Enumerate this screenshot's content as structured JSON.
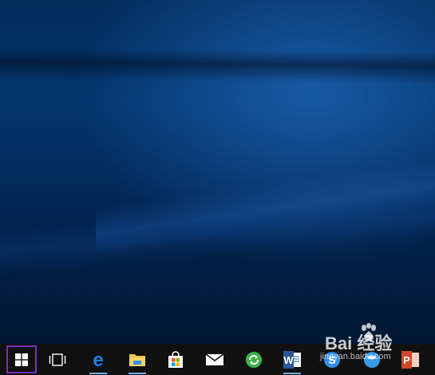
{
  "desktop": {
    "wallpaper": "windows-10-hero-blue"
  },
  "taskbar": {
    "background": "#101010",
    "start_highlight": "#7a2fbf",
    "icons": [
      {
        "name": "windows-logo-icon",
        "app": "Start"
      },
      {
        "name": "task-view-icon",
        "app": "Task View"
      },
      {
        "name": "edge-icon",
        "app": "Microsoft Edge"
      },
      {
        "name": "file-explorer-icon",
        "app": "File Explorer"
      },
      {
        "name": "store-icon",
        "app": "Store"
      },
      {
        "name": "mail-icon",
        "app": "Mail"
      },
      {
        "name": "refresh-app-icon",
        "app": "Update"
      },
      {
        "name": "word-icon",
        "app": "Word"
      },
      {
        "name": "sogou-icon",
        "app": "Sogou"
      },
      {
        "name": "sogou-browser-icon",
        "app": "Browser"
      },
      {
        "name": "powerpoint-icon",
        "app": "PowerPoint"
      }
    ]
  },
  "watermark": {
    "logo": "Bai  经验",
    "url": "jingyan.baidu.com"
  }
}
